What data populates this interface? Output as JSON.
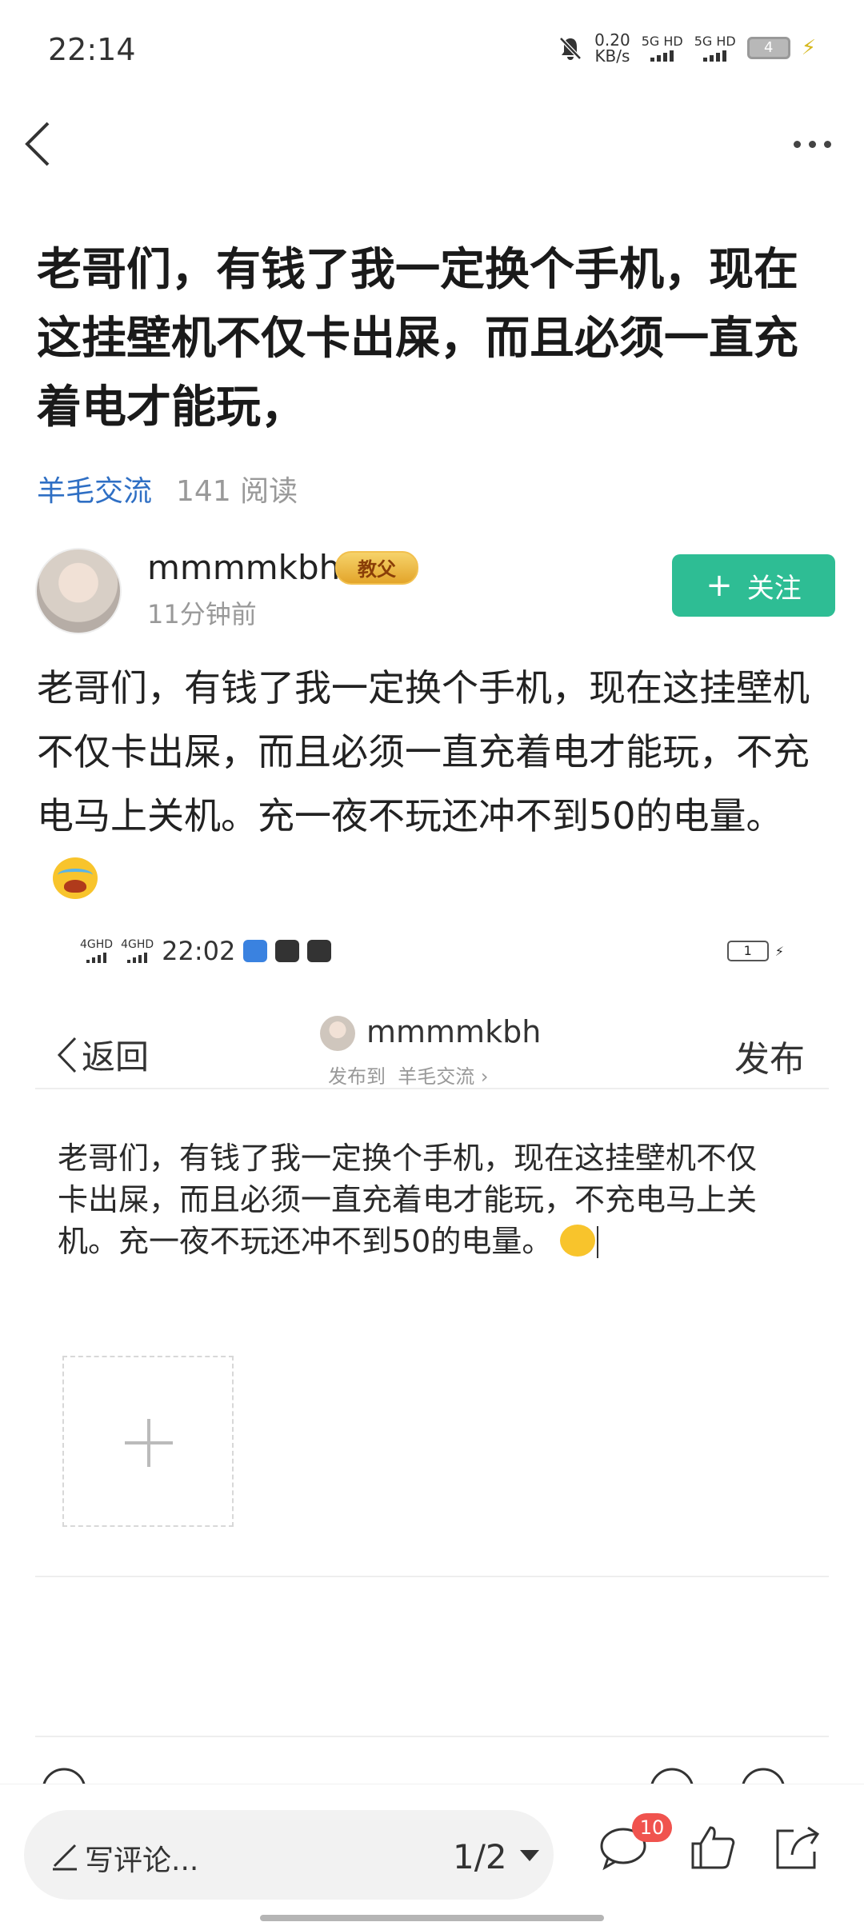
{
  "status_bar": {
    "time": "22:14",
    "net_speed_value": "0.20",
    "net_speed_unit": "KB/s",
    "sim1_label": "5G HD",
    "sim2_label": "5G HD",
    "battery": "4"
  },
  "post": {
    "title": "老哥们，有钱了我一定换个手机，现在这挂壁机不仅卡出屎，而且必须一直充着电才能玩，",
    "board": "羊毛交流",
    "reads": "141 阅读",
    "author": "mmmmkbh",
    "author_badge": "教父",
    "time_ago": "11分钟前",
    "follow_label": "关注",
    "body": "老哥们，有钱了我一定换个手机，现在这挂壁机不仅卡出屎，而且必须一直充着电才能玩，不充电马上关机。充一夜不玩还冲不到50的电量。"
  },
  "embedded_screenshot": {
    "status_sig1": "4GHD",
    "status_sig2": "4GHD",
    "status_time": "22:02",
    "battery": "1",
    "back_label": "返回",
    "username": "mmmmkbh",
    "publish_to_prefix": "发布到",
    "publish_to_board": "羊毛交流",
    "publish_label": "发布",
    "draft_text": "老哥们，有钱了我一定换个手机，现在这挂壁机不仅卡出屎，而且必须一直充着电才能玩，不充电马上关机。充一夜不玩还冲不到50的电量。"
  },
  "bottom_bar": {
    "comment_placeholder": "写评论...",
    "page_indicator": "1/2",
    "comment_count": "10"
  },
  "colors": {
    "accent_green": "#2ebd94",
    "link_blue": "#2f6fc4",
    "badge_red": "#f0534e"
  }
}
